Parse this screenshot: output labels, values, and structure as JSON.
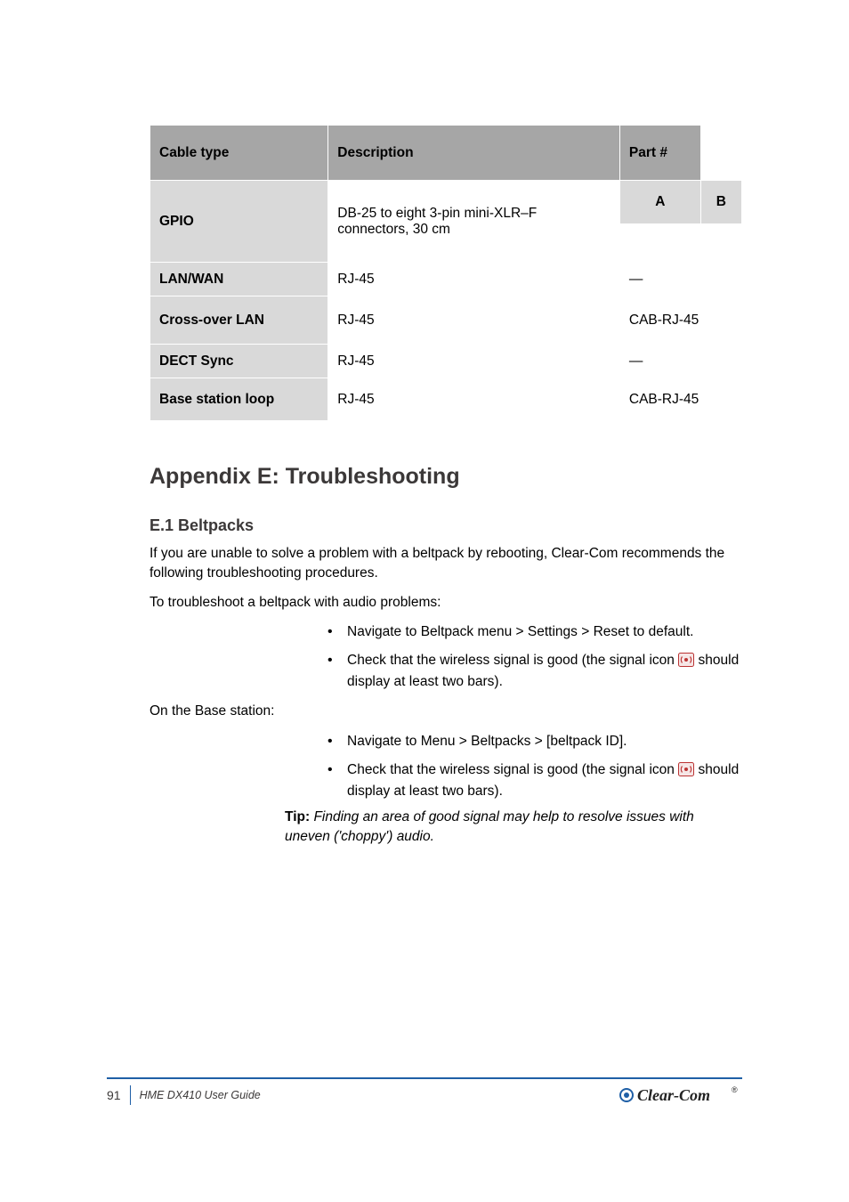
{
  "table": {
    "col1": "Cable type",
    "col2": "Description",
    "col3": "Part #",
    "rows": [
      {
        "type": "row2-split",
        "label_rowspan": 2,
        "label": "GPIO",
        "desc_rowspan": 2,
        "desc": "DB-25 to eight 3-pin mini-XLR–F connectors, 30 cm",
        "sub_ab": [
          "A",
          "B"
        ],
        "sub_vals": [
          "",
          ""
        ]
      },
      {
        "type": "row",
        "label": "LAN/WAN",
        "desc": "RJ-45",
        "part": "—"
      },
      {
        "type": "row-tall",
        "label": "Cross-over LAN",
        "desc": "RJ-45",
        "part": "CAB-RJ-45"
      },
      {
        "type": "row",
        "label": "DECT Sync",
        "desc": "RJ-45",
        "part": "—"
      },
      {
        "type": "row-tall",
        "label": "Base station loop",
        "desc": "RJ-45",
        "part": "CAB-RJ-45"
      }
    ]
  },
  "appendix_title": "Appendix E: Troubleshooting",
  "sub_title": "E.1 Beltpacks",
  "para1": "If you are unable to solve a problem with a beltpack by rebooting, Clear-Com recommends the following troubleshooting procedures.",
  "para2": "To troubleshoot a beltpack with audio problems:",
  "list1": [
    {
      "text": "Navigate to Beltpack menu > Settings > Reset to default.",
      "hasIcon": false
    },
    {
      "prefix": "Check that the wireless signal is good (the signal icon ",
      "suffix": " should display at least two bars).",
      "hasIcon": true
    }
  ],
  "para3": "On the Base station:",
  "list2": [
    {
      "text": "Navigate to Menu > Beltpacks > [beltpack ID].",
      "hasIcon": false
    },
    {
      "prefix": "Check that the wireless signal is good (the signal icon ",
      "suffix": " should display at least two bars).",
      "hasIcon": true
    }
  ],
  "tip": {
    "label": "Tip:",
    "text": "Finding an area of good signal may help to resolve issues with uneven ('choppy') audio."
  },
  "footer": {
    "page": "91",
    "doc": "HME DX410 User Guide",
    "brand": "Clear-Com"
  }
}
